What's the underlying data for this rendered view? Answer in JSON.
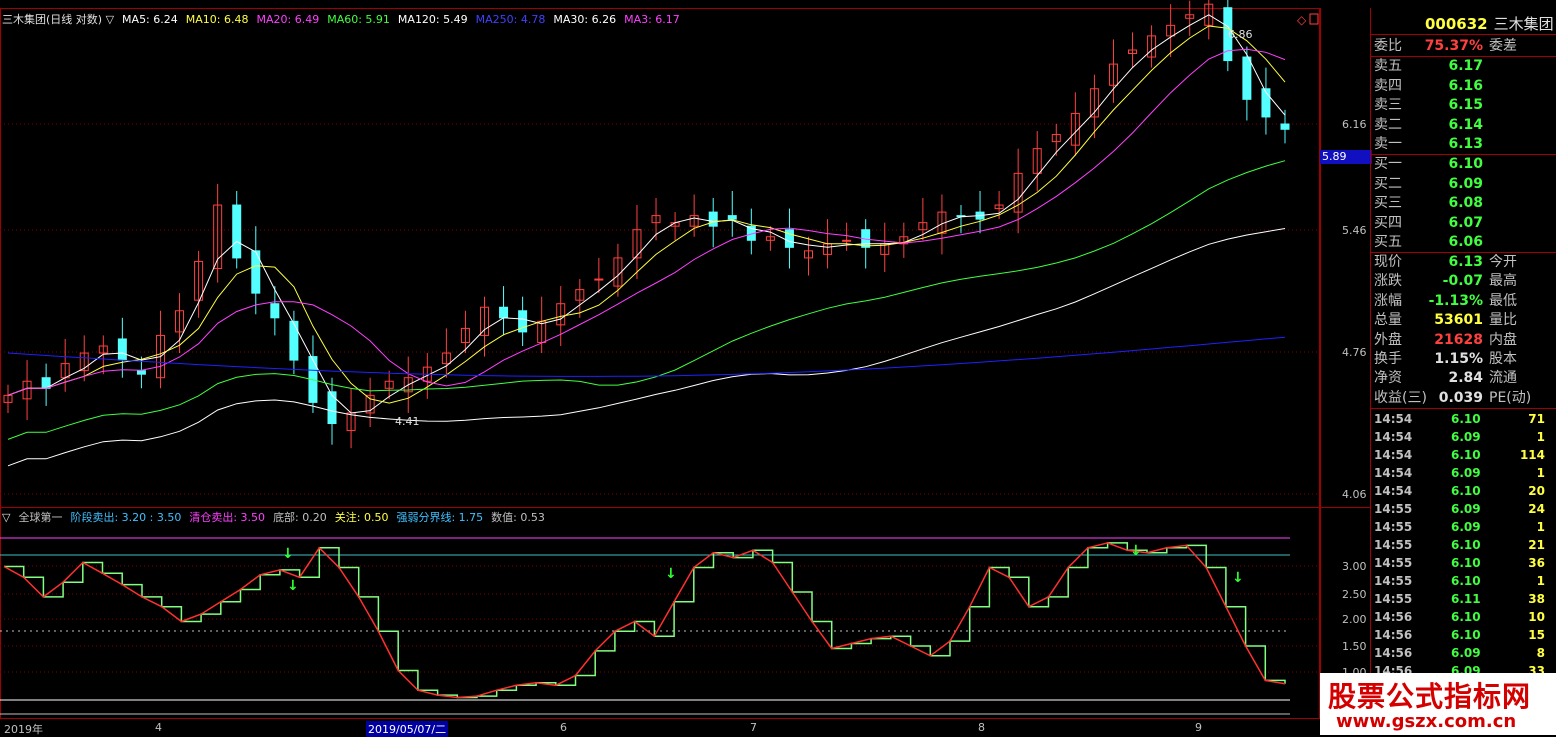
{
  "main_header": {
    "title": "三木集团(日线 对数)",
    "indicators": [
      {
        "text": "MA5: 6.24",
        "color": "#ffffff"
      },
      {
        "text": "MA10: 6.48",
        "color": "#ffff40"
      },
      {
        "text": "MA20: 6.49",
        "color": "#ff40ff"
      },
      {
        "text": "MA60: 5.91",
        "color": "#40ff40"
      },
      {
        "text": "MA120: 5.49",
        "color": "#ffffff"
      },
      {
        "text": "MA250: 4.78",
        "color": "#4040ff"
      },
      {
        "text": "MA30: 6.26",
        "color": "#ffffff"
      },
      {
        "text": "MA3: 6.17",
        "color": "#ff40ff"
      }
    ]
  },
  "sub_header": {
    "items": [
      {
        "text": "全球第一",
        "color": "#c0c0c0"
      },
      {
        "text": "阶段卖出: 3.20 : 3.50",
        "color": "#40c0ff"
      },
      {
        "text": "清仓卖出: 3.50",
        "color": "#ff40ff"
      },
      {
        "text": "底部: 0.20",
        "color": "#c0c0c0"
      },
      {
        "text": "关注: 0.50",
        "color": "#ffff40"
      },
      {
        "text": "强弱分界线: 1.75",
        "color": "#40c0ff"
      },
      {
        "text": "数值: 0.53",
        "color": "#c0c0c0"
      }
    ]
  },
  "price_axis": [
    "6.16",
    "5.46",
    "4.76",
    "4.06"
  ],
  "indicator_axis": [
    "3.00",
    "2.50",
    "2.00",
    "1.50",
    "1.00"
  ],
  "date_axis": [
    "2019年",
    "4",
    "6",
    "7",
    "8",
    "9"
  ],
  "cursor_date": "2019/05/07/二",
  "current_price_tag": "5.89",
  "annotations": {
    "high": "6.86",
    "low": "4.41"
  },
  "quote": {
    "code": "000632",
    "name": "三木集团",
    "weibi_label": "委比",
    "weibi_value": "75.37%",
    "weicha_label": "委差",
    "asks": [
      {
        "label": "卖五",
        "price": "6.17"
      },
      {
        "label": "卖四",
        "price": "6.16"
      },
      {
        "label": "卖三",
        "price": "6.15"
      },
      {
        "label": "卖二",
        "price": "6.14"
      },
      {
        "label": "卖一",
        "price": "6.13"
      }
    ],
    "bids": [
      {
        "label": "买一",
        "price": "6.10"
      },
      {
        "label": "买二",
        "price": "6.09"
      },
      {
        "label": "买三",
        "price": "6.08"
      },
      {
        "label": "买四",
        "price": "6.07"
      },
      {
        "label": "买五",
        "price": "6.06"
      }
    ],
    "stats": [
      {
        "label": "现价",
        "value": "6.13",
        "label2": "今开",
        "color": "#40ff40"
      },
      {
        "label": "涨跌",
        "value": "-0.07",
        "label2": "最高",
        "color": "#40ff40"
      },
      {
        "label": "涨幅",
        "value": "-1.13%",
        "label2": "最低",
        "color": "#40ff40"
      },
      {
        "label": "总量",
        "value": "53601",
        "label2": "量比",
        "color": "#ffff40"
      },
      {
        "label": "外盘",
        "value": "21628",
        "label2": "内盘",
        "color": "#ff4040"
      },
      {
        "label": "换手",
        "value": "1.15%",
        "label2": "股本",
        "color": "#e0e0e0"
      },
      {
        "label": "净资",
        "value": "2.84",
        "label2": "流通",
        "color": "#e0e0e0"
      },
      {
        "label": "收益(三)",
        "value": "0.039",
        "label2": "PE(动)",
        "color": "#e0e0e0"
      }
    ],
    "ticks": [
      {
        "time": "14:54",
        "price": "6.10",
        "vol": "71",
        "vcolor": "#ffff40"
      },
      {
        "time": "14:54",
        "price": "6.09",
        "vol": "1",
        "vcolor": "#ffff40"
      },
      {
        "time": "14:54",
        "price": "6.10",
        "vol": "114",
        "vcolor": "#ffff40"
      },
      {
        "time": "14:54",
        "price": "6.09",
        "vol": "1",
        "vcolor": "#ffff40"
      },
      {
        "time": "14:54",
        "price": "6.10",
        "vol": "20",
        "vcolor": "#ffff40"
      },
      {
        "time": "14:55",
        "price": "6.09",
        "vol": "24",
        "vcolor": "#ffff40"
      },
      {
        "time": "14:55",
        "price": "6.09",
        "vol": "1",
        "vcolor": "#ffff40"
      },
      {
        "time": "14:55",
        "price": "6.10",
        "vol": "21",
        "vcolor": "#ffff40"
      },
      {
        "time": "14:55",
        "price": "6.10",
        "vol": "36",
        "vcolor": "#ffff40"
      },
      {
        "time": "14:55",
        "price": "6.10",
        "vol": "1",
        "vcolor": "#ffff40"
      },
      {
        "time": "14:55",
        "price": "6.11",
        "vol": "38",
        "vcolor": "#ffff40"
      },
      {
        "time": "14:56",
        "price": "6.10",
        "vol": "10",
        "vcolor": "#ffff40"
      },
      {
        "time": "14:56",
        "price": "6.10",
        "vol": "15",
        "vcolor": "#ffff40"
      },
      {
        "time": "14:56",
        "price": "6.09",
        "vol": "8",
        "vcolor": "#ffff40"
      },
      {
        "time": "14:56",
        "price": "6.09",
        "vol": "33",
        "vcolor": "#ffff40"
      }
    ]
  },
  "watermark": {
    "title": "股票公式指标网",
    "url": "www.gszx.com.cn"
  },
  "chart_data": {
    "type": "line",
    "price_series_close": [
      4.62,
      4.7,
      4.66,
      4.8,
      4.86,
      4.9,
      4.82,
      4.74,
      4.96,
      5.1,
      5.38,
      5.7,
      5.4,
      5.2,
      5.06,
      4.82,
      4.58,
      4.46,
      4.52,
      4.62,
      4.7,
      4.72,
      4.78,
      4.86,
      5.0,
      5.12,
      5.06,
      4.98,
      5.04,
      5.14,
      5.22,
      5.28,
      5.4,
      5.56,
      5.64,
      5.6,
      5.64,
      5.58,
      5.62,
      5.5,
      5.52,
      5.46,
      5.44,
      5.48,
      5.5,
      5.46,
      5.48,
      5.52,
      5.6,
      5.66,
      5.64,
      5.62,
      5.7,
      5.88,
      6.02,
      6.1,
      6.22,
      6.36,
      6.5,
      6.58,
      6.66,
      6.72,
      6.78,
      6.84,
      6.52,
      6.3,
      6.2,
      6.13
    ],
    "indicator_series": [
      2.92,
      2.7,
      2.3,
      2.6,
      3.0,
      2.78,
      2.55,
      2.3,
      2.1,
      1.8,
      1.95,
      2.2,
      2.45,
      2.75,
      2.85,
      2.7,
      3.3,
      2.9,
      2.3,
      1.6,
      0.8,
      0.4,
      0.3,
      0.25,
      0.28,
      0.4,
      0.5,
      0.55,
      0.5,
      0.7,
      1.2,
      1.6,
      1.8,
      1.5,
      2.2,
      2.9,
      3.2,
      3.1,
      3.25,
      3.0,
      2.4,
      1.8,
      1.25,
      1.35,
      1.45,
      1.5,
      1.3,
      1.1,
      1.4,
      2.1,
      2.9,
      2.7,
      2.1,
      2.3,
      2.9,
      3.3,
      3.4,
      3.25,
      3.2,
      3.3,
      3.35,
      2.9,
      2.1,
      1.3,
      0.6,
      0.53
    ]
  }
}
